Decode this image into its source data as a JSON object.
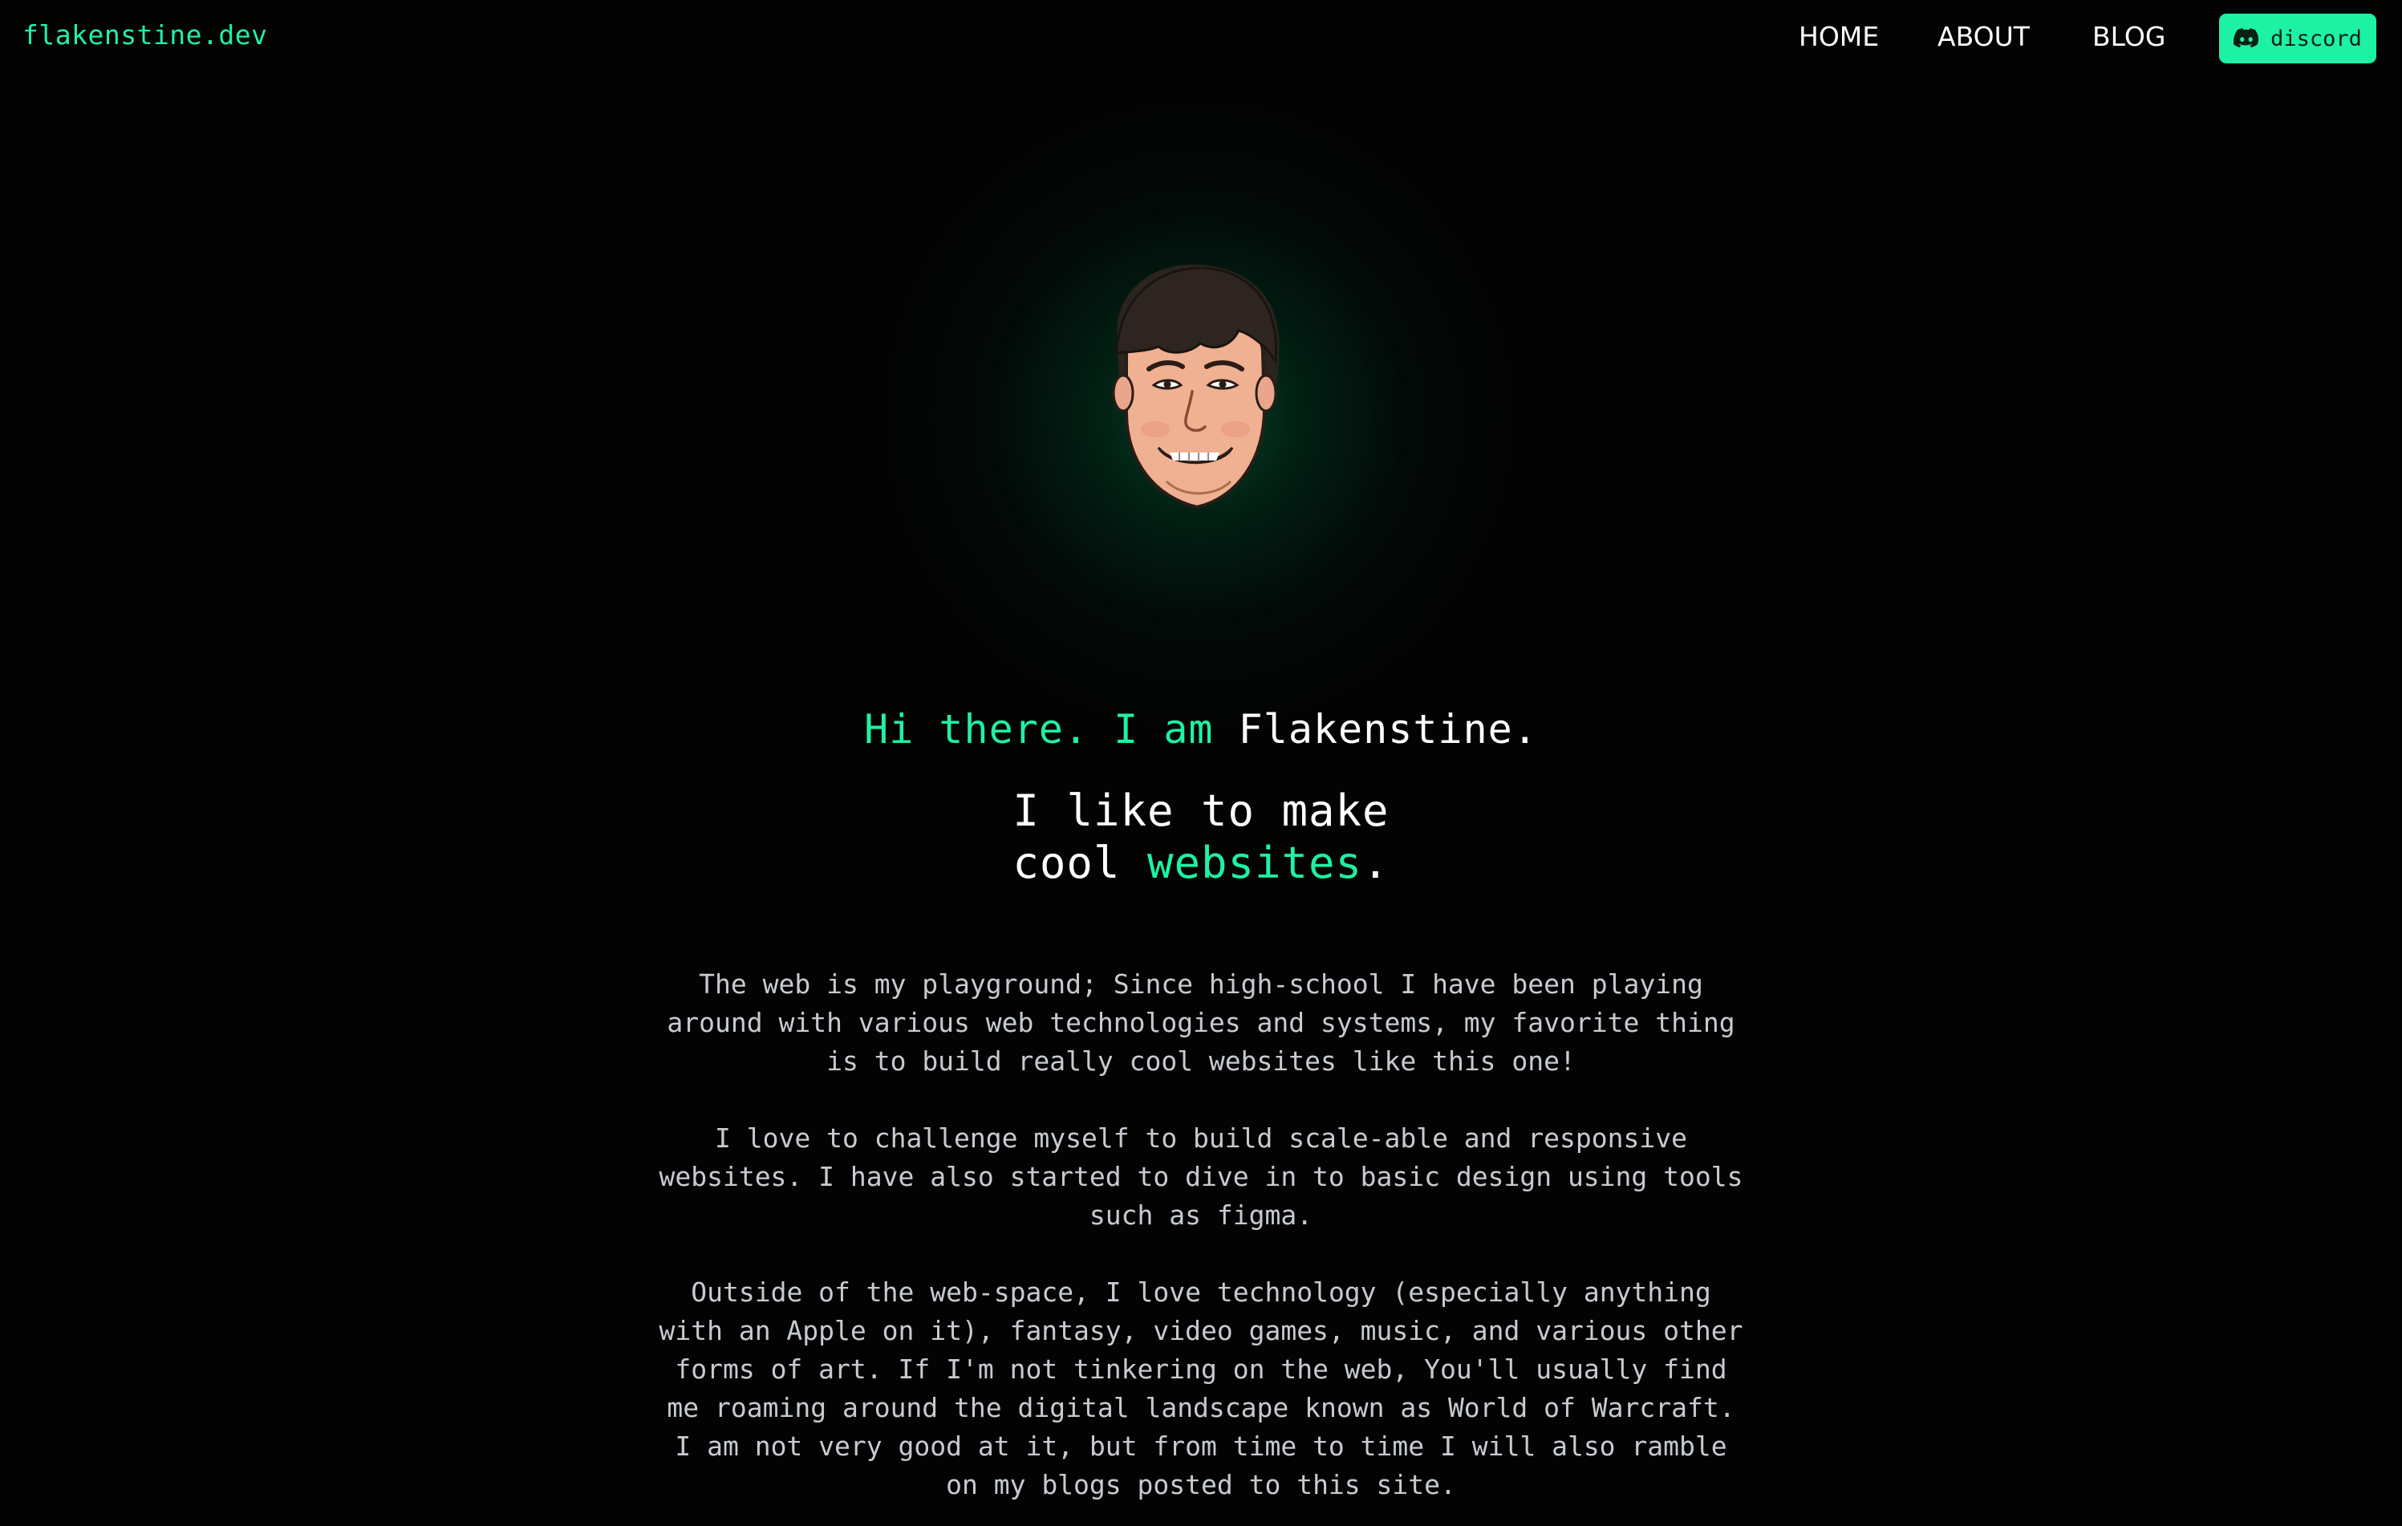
{
  "header": {
    "logo": "flakenstine.dev",
    "nav": [
      {
        "label": "HOME"
      },
      {
        "label": "ABOUT"
      },
      {
        "label": "BLOG"
      }
    ],
    "discord_button": {
      "label": "discord",
      "icon": "discord-icon"
    }
  },
  "hero": {
    "avatar_alt": "cartoon-portrait",
    "greeting_accent": "Hi there. I am ",
    "greeting_name": "Flakenstine",
    "greeting_end": ".",
    "tagline_line1": "I like to make",
    "tagline_line2_start": "cool ",
    "tagline_accent": "websites",
    "tagline_end": "."
  },
  "about": {
    "paragraphs": [
      "The web is my playground; Since high-school I have been playing around with various web technologies and systems, my favorite thing is to build really cool websites like this one!",
      "I love to challenge myself to build scale-able and responsive websites. I have also started to dive in to basic design using tools such as figma.",
      "Outside of the web-space, I love technology (especially anything with an Apple on it), fantasy, video games, music, and various other forms of art. If I'm not tinkering on the web, You'll usually find me roaming around the digital landscape known as World of Warcraft. I am not very good at it, but from time to time I will also ramble on my blogs posted to this site."
    ]
  },
  "colors": {
    "background": "#030303",
    "accent": "#1df2a4",
    "text": "#ffffff",
    "muted_text": "#c7cbd1"
  }
}
